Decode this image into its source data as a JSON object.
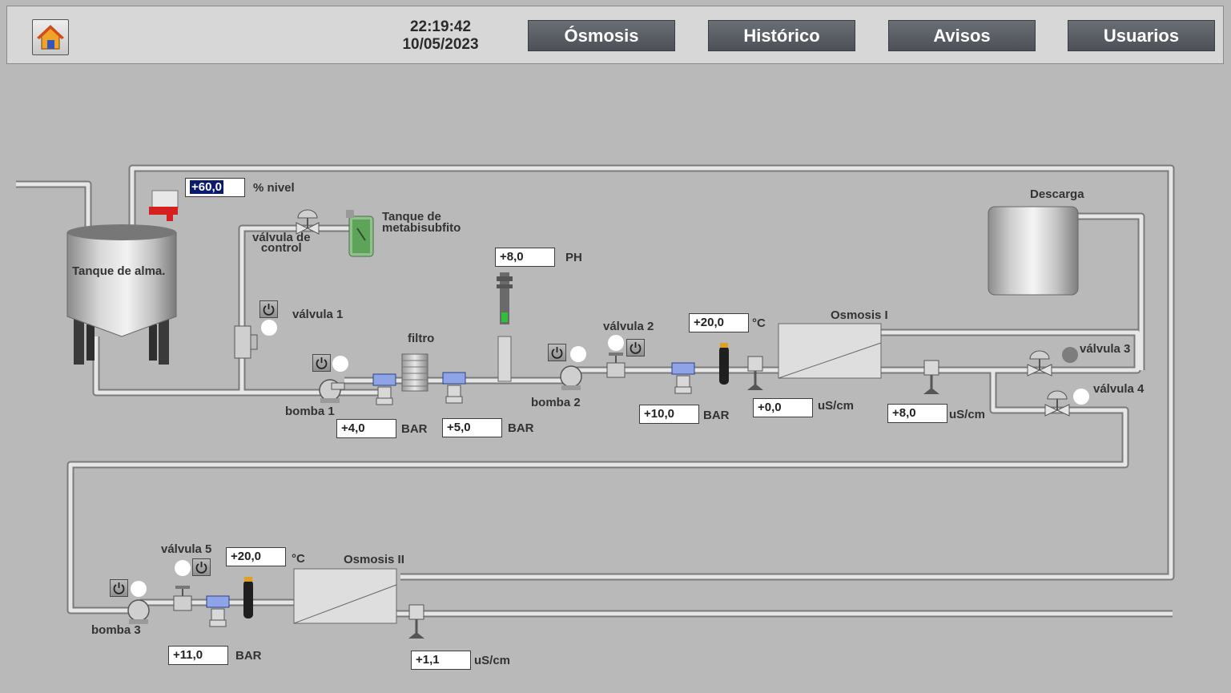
{
  "header": {
    "time": "22:19:42",
    "date": "10/05/2023",
    "nav": [
      "Ósmosis",
      "Histórico",
      "Avisos",
      "Usuarios"
    ]
  },
  "labels": {
    "nivel_unit": "% nivel",
    "tanque_alma": "Tanque de alma.",
    "tanque_metab_1": "Tanque de",
    "tanque_metab_2": "metabisubfito",
    "valvula_control_1": "válvula de",
    "valvula_control_2": "control",
    "valvula1": "válvula 1",
    "filtro": "filtro",
    "ph_unit": "PH",
    "valvula2": "válvula 2",
    "osmosis1": "Osmosis I",
    "descarga": "Descarga",
    "valvula3": "válvula 3",
    "valvula4": "válvula 4",
    "bomba1": "bomba 1",
    "bomba2": "bomba 2",
    "bomba3": "bomba 3",
    "bar": "BAR",
    "degc": "°C",
    "uscm": "uS/cm",
    "valvula5": "válvula 5",
    "osmosis2": "Osmosis II"
  },
  "values": {
    "nivel": "+60,0",
    "ph": "+8,0",
    "pres_filtro_in": "+4,0",
    "pres_filtro_out": "+5,0",
    "pres_osm1": "+10,0",
    "temp_osm1": "+20,0",
    "cond_osm1_in": "+0,0",
    "cond_osm1_out": "+8,0",
    "temp_osm2": "+20,0",
    "pres_osm2": "+11,0",
    "cond_osm2": "+1,1"
  },
  "status": {
    "valvula1": "on",
    "bomba1": "on",
    "bomba2": "on",
    "valvula2": "on",
    "valvula3": "off",
    "valvula4": "on",
    "valvula5": "on",
    "bomba3": "on"
  },
  "colors": {
    "background": "#b9b9b9",
    "nav_button": "#55585f",
    "led_on": "#ffffff",
    "led_off": "#7d7d7d",
    "pipe": "#dcdcdc"
  }
}
